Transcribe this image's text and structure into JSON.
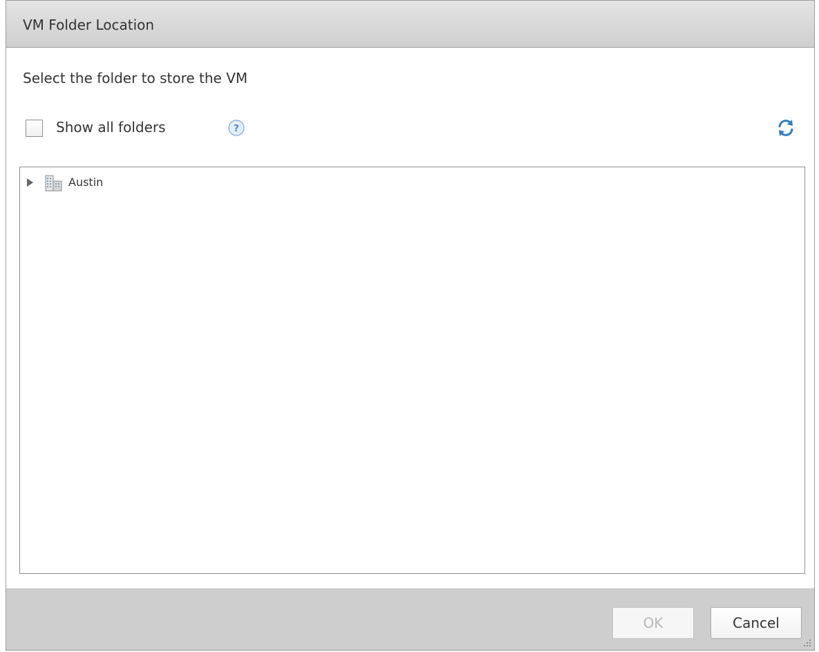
{
  "dialog": {
    "title": "VM Folder Location",
    "subtitle": "Select the folder to store the VM"
  },
  "options": {
    "show_all_folders_label": "Show all folders",
    "show_all_folders_checked": false,
    "help_icon": "help-icon",
    "refresh_icon": "refresh-icon"
  },
  "tree": {
    "items": [
      {
        "label": "Austin",
        "icon": "datacenter-icon",
        "expanded": false
      }
    ]
  },
  "footer": {
    "ok_label": "OK",
    "ok_enabled": false,
    "cancel_label": "Cancel"
  },
  "colors": {
    "titlebar": "#d8d8d8",
    "footer": "#cecece",
    "accent": "#2f7fc4"
  }
}
